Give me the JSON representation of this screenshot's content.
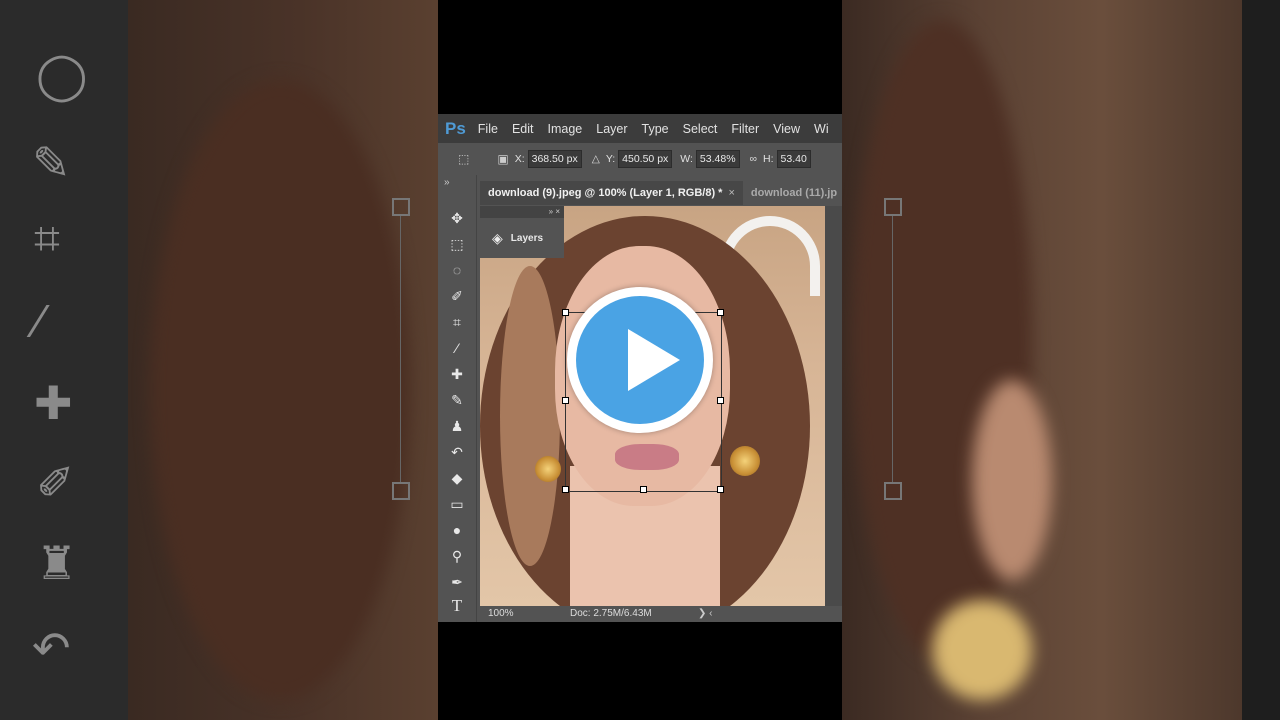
{
  "app": {
    "logo": "Ps"
  },
  "menu": [
    "File",
    "Edit",
    "Image",
    "Layer",
    "Type",
    "Select",
    "Filter",
    "View",
    "Wi"
  ],
  "options": {
    "x_label": "X:",
    "x_value": "368.50 px",
    "y_label": "Y:",
    "y_value": "450.50 px",
    "w_label": "W:",
    "w_value": "53.48%",
    "h_label": "H:",
    "h_value": "53.40"
  },
  "tabs": [
    {
      "label": "download (9).jpeg @ 100% (Layer 1, RGB/8) *",
      "close": "×"
    },
    {
      "label": "download (11).jp"
    }
  ],
  "layers_panel": {
    "label": "Layers",
    "header_icons": "» ×"
  },
  "status": {
    "zoom": "100%",
    "doc": "Doc: 2.75M/6.43M",
    "arrows": "❯  ‹"
  },
  "toolbar_collapse": "»",
  "tools": [
    "move-icon",
    "marquee-icon",
    "lasso-icon",
    "quick-select-icon",
    "crop-icon",
    "eyedropper-icon",
    "healing-icon",
    "brush-icon",
    "stamp-icon",
    "history-brush-icon",
    "eraser-icon",
    "gradient-icon",
    "blur-icon",
    "dodge-icon",
    "pen-icon",
    "type-icon"
  ],
  "colors": {
    "play_blue": "#4aa3e4",
    "ps_blue": "#4f9bd6",
    "menubar": "#3c3c3c",
    "panel": "#535353"
  }
}
